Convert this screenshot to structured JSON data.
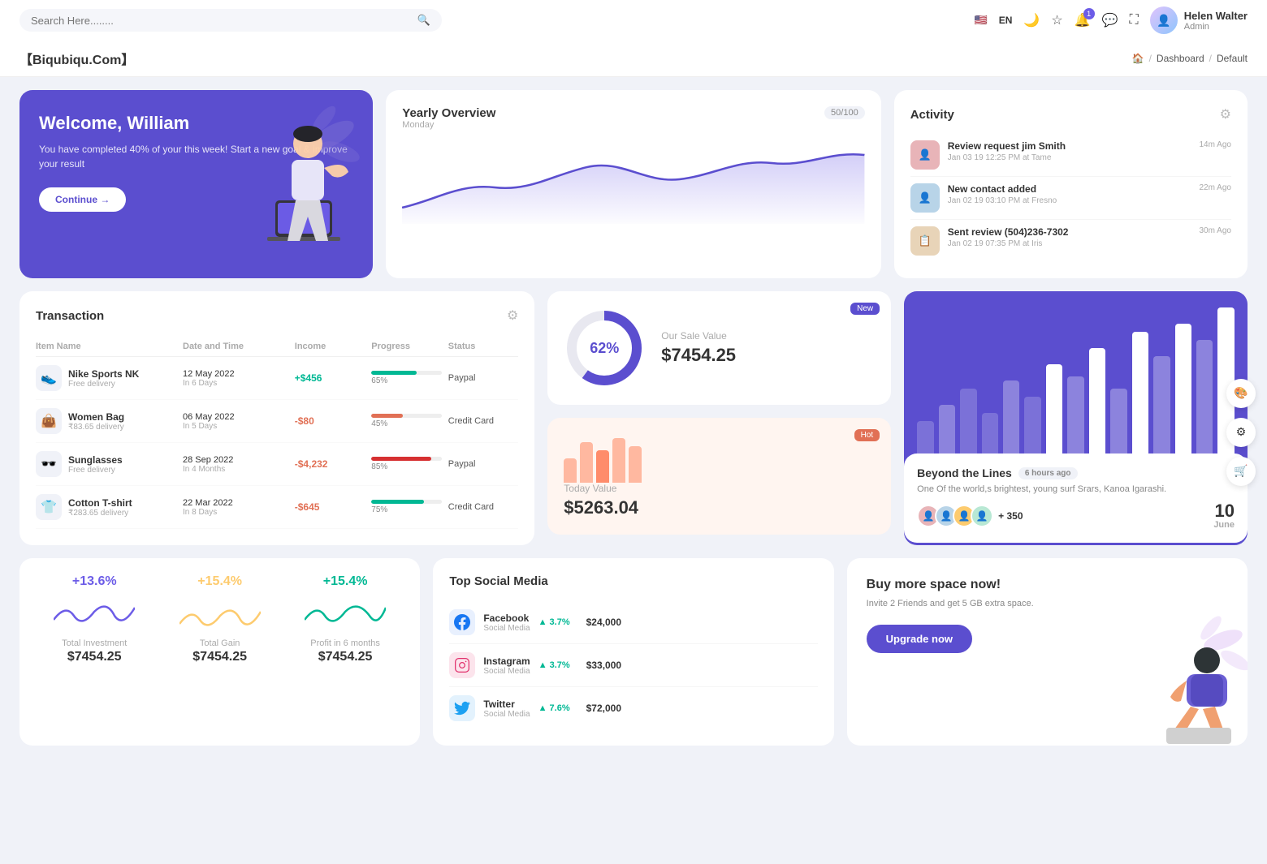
{
  "header": {
    "search_placeholder": "Search Here........",
    "lang": "EN",
    "user_name": "Helen Walter",
    "user_role": "Admin",
    "notification_count": "1"
  },
  "brand": {
    "name": "【Biqubiqu.Com】",
    "breadcrumb": [
      "Home",
      "Dashboard",
      "Default"
    ]
  },
  "welcome": {
    "title": "Welcome, William",
    "text": "You have completed 40% of your this week! Start a new goal & improve your result",
    "button": "Continue →"
  },
  "yearly": {
    "title": "Yearly Overview",
    "badge": "50/100",
    "sub": "Monday"
  },
  "activity": {
    "title": "Activity",
    "items": [
      {
        "title": "Review request jim Smith",
        "sub": "Jan 03 19 12:25 PM at Tame",
        "time": "14m Ago",
        "color": "#e8b4b8"
      },
      {
        "title": "New contact added",
        "sub": "Jan 02 19 03:10 PM at Fresno",
        "time": "22m Ago",
        "color": "#b8d4e8"
      },
      {
        "title": "Sent review (504)236-7302",
        "sub": "Jan 02 19 07:35 PM at Iris",
        "time": "30m Ago",
        "color": "#e8d4b8"
      }
    ]
  },
  "transaction": {
    "title": "Transaction",
    "columns": [
      "Item Name",
      "Date and Time",
      "Income",
      "Progress",
      "Status"
    ],
    "rows": [
      {
        "name": "Nike Sports NK",
        "sub": "Free delivery",
        "date": "12 May 2022",
        "date_sub": "In 6 Days",
        "income": "+$456",
        "income_type": "pos",
        "progress": 65,
        "progress_color": "#00b894",
        "status": "Paypal",
        "icon": "👟"
      },
      {
        "name": "Women Bag",
        "sub": "₹83.65 delivery",
        "date": "06 May 2022",
        "date_sub": "In 5 Days",
        "income": "-$80",
        "income_type": "neg",
        "progress": 45,
        "progress_color": "#e17055",
        "status": "Credit Card",
        "icon": "👜"
      },
      {
        "name": "Sunglasses",
        "sub": "Free delivery",
        "date": "28 Sep 2022",
        "date_sub": "In 4 Months",
        "income": "-$4,232",
        "income_type": "neg",
        "progress": 85,
        "progress_color": "#d63031",
        "status": "Paypal",
        "icon": "🕶️"
      },
      {
        "name": "Cotton T-shirt",
        "sub": "₹283.65 delivery",
        "date": "22 Mar 2022",
        "date_sub": "In 8 Days",
        "income": "-$645",
        "income_type": "neg",
        "progress": 75,
        "progress_color": "#00b894",
        "status": "Credit Card",
        "icon": "👕"
      }
    ]
  },
  "sale_value": {
    "badge": "New",
    "percent": "62%",
    "label": "Our Sale Value",
    "value": "$7454.25"
  },
  "today_value": {
    "badge": "Hot",
    "label": "Today Value",
    "value": "$5263.04",
    "bars": [
      30,
      50,
      40,
      55,
      45
    ]
  },
  "beyond": {
    "title": "Beyond the Lines",
    "time": "6 hours ago",
    "text": "One Of the world,s brightest, young surf Srars, Kanoa Igarashi.",
    "plus_count": "+ 350",
    "date_num": "10",
    "date_mon": "June",
    "bars": [
      40,
      60,
      80,
      50,
      90,
      70,
      110,
      95,
      130,
      80,
      150,
      120,
      160,
      140,
      180
    ]
  },
  "stats": [
    {
      "percent": "+13.6%",
      "color": "#6c5ce7",
      "label": "Total Investment",
      "value": "$7454.25"
    },
    {
      "percent": "+15.4%",
      "color": "#fdcb6e",
      "label": "Total Gain",
      "value": "$7454.25"
    },
    {
      "percent": "+15.4%",
      "color": "#00b894",
      "label": "Profit in 6 months",
      "value": "$7454.25"
    }
  ],
  "social": {
    "title": "Top Social Media",
    "items": [
      {
        "name": "Facebook",
        "sub": "Social Media",
        "change": "3.7%",
        "amount": "$24,000",
        "color": "#1877f2",
        "icon": "f"
      },
      {
        "name": "Instagram",
        "sub": "Social Media",
        "change": "3.7%",
        "amount": "$33,000",
        "color": "#e1306c",
        "icon": "ig"
      },
      {
        "name": "Twitter",
        "sub": "Social Media",
        "change": "7.6%",
        "amount": "$72,000",
        "color": "#1da1f2",
        "icon": "tw"
      }
    ]
  },
  "space": {
    "title": "Buy more space now!",
    "text": "Invite 2 Friends and get 5 GB extra space.",
    "button": "Upgrade now"
  }
}
